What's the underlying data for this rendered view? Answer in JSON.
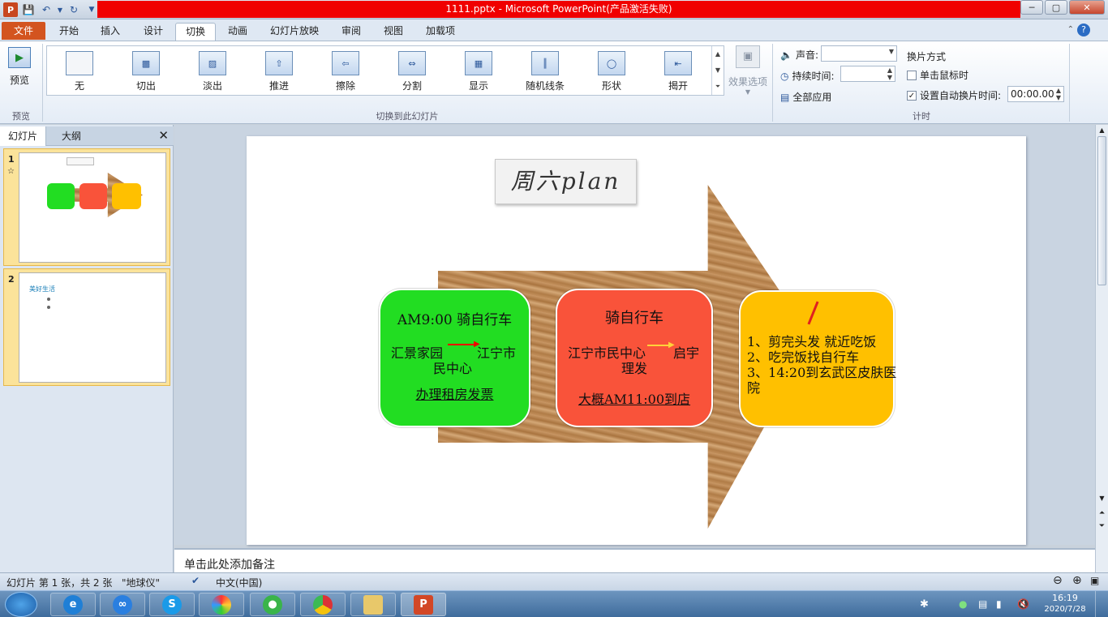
{
  "window": {
    "title": "1111.pptx - Microsoft PowerPoint(产品激活失败)"
  },
  "tabs": {
    "file": "文件",
    "items": [
      "开始",
      "插入",
      "设计",
      "切换",
      "动画",
      "幻灯片放映",
      "审阅",
      "视图",
      "加载项"
    ],
    "active_index": 3
  },
  "ribbon": {
    "preview_label": "预览",
    "preview_group": "预览",
    "transitions": [
      "无",
      "切出",
      "淡出",
      "推进",
      "擦除",
      "分割",
      "显示",
      "随机线条",
      "形状",
      "揭开"
    ],
    "transitions_group": "切换到此幻灯片",
    "effect_options": "效果选项",
    "sound_label": "声音:",
    "sound_value": "",
    "duration_label": "持续时间:",
    "duration_value": "",
    "apply_all": "全部应用",
    "advance_title": "换片方式",
    "on_click": "单击鼠标时",
    "on_click_checked": false,
    "after_label": "设置自动换片时间:",
    "after_checked": true,
    "after_value": "00:00.00",
    "timing_group": "计时"
  },
  "leftpane": {
    "tab_slides": "幻灯片",
    "tab_outline": "大纲",
    "thumbs": [
      {
        "num": "1",
        "star": "☆"
      },
      {
        "num": "2",
        "text": "美好生活"
      }
    ]
  },
  "slide": {
    "title": "周六plan",
    "box1": {
      "heading": "AM9:00 骑自行车",
      "from": "汇景家园",
      "to": "江宁市",
      "line2": "民中心",
      "link": "办理租房发票",
      "color": "#22dd22"
    },
    "box2": {
      "heading": "骑自行车",
      "from": "江宁市民中心",
      "to": "启宇",
      "line2": "理发",
      "link": "大概AM11:00到店",
      "color": "#f9533a"
    },
    "box3": {
      "lines": [
        "1、剪完头发 就近吃饭",
        "2、吃完饭找自行车",
        "3、14:20到玄武区皮肤医",
        "院"
      ],
      "color": "#ffc000"
    }
  },
  "notes_placeholder": "单击此处添加备注",
  "status": {
    "slide_info": "幻灯片 第 1 张，共 2 张",
    "theme": "\"地球仪\"",
    "language": "中文(中国)"
  },
  "tray": {
    "time": "16:19",
    "date": "2020/7/28"
  }
}
